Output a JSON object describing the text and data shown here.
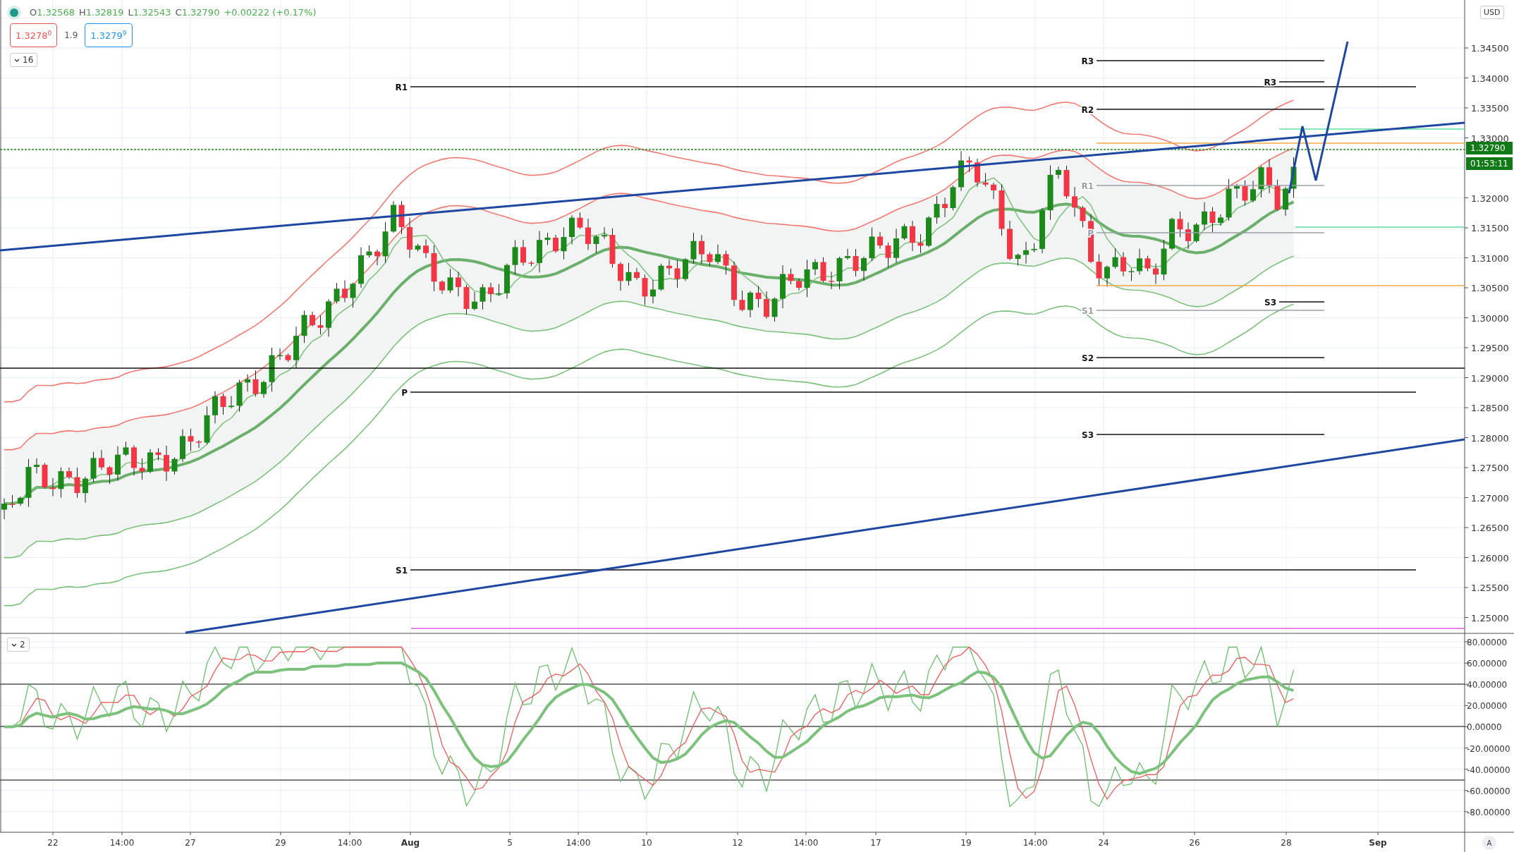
{
  "legend": {
    "ohlc": [
      {
        "label": "O",
        "value": "1.32568"
      },
      {
        "label": "H",
        "value": "1.32819"
      },
      {
        "label": "L",
        "value": "1.32543"
      },
      {
        "label": "C",
        "value": "1.32790"
      }
    ],
    "change": "+0.00222 (+0.17%)",
    "bid": "1.3278$^{0}$",
    "spread": "1.9",
    "ask": "1.3279$^{9}$",
    "collapse_count": "16"
  },
  "oscillator_pane": {
    "collapse_count": "2"
  },
  "currency_button": "USD",
  "price_tag": "1.32790",
  "countdown": "01:53:11",
  "pivots": [
    {
      "label": "R1",
      "muted": false
    },
    {
      "label": "P",
      "muted": false
    },
    {
      "label": "S1",
      "muted": false
    },
    {
      "label": "R3",
      "muted": false
    },
    {
      "label": "R2",
      "muted": false
    },
    {
      "label": "R1",
      "muted": true
    },
    {
      "label": "P",
      "muted": true
    },
    {
      "label": "S1",
      "muted": true
    },
    {
      "label": "S2",
      "muted": false
    },
    {
      "label": "S3",
      "muted": false
    },
    {
      "label": "R3",
      "muted": false
    },
    {
      "label": "S3",
      "muted": false
    }
  ],
  "price_axis": [
    "1.34500",
    "1.34000",
    "1.33500",
    "1.33000",
    "1.32000",
    "1.31500",
    "1.31000",
    "1.30500",
    "1.30000",
    "1.29500",
    "1.29000",
    "1.28500",
    "1.28000",
    "1.27500",
    "1.27000",
    "1.26500",
    "1.26000",
    "1.25500",
    "1.25000"
  ],
  "oscillator_axis": [
    "80.00000",
    "60.00000",
    "40.00000",
    "20.00000",
    "0.00000",
    "-20.00000",
    "-40.00000",
    "-60.00000",
    "-80.00000"
  ],
  "time_axis": [
    {
      "label": "22",
      "kind": "day"
    },
    {
      "label": "14:00",
      "kind": "time"
    },
    {
      "label": "27",
      "kind": "day"
    },
    {
      "label": "29",
      "kind": "day"
    },
    {
      "label": "14:00",
      "kind": "time"
    },
    {
      "label": "Aug",
      "kind": "month"
    },
    {
      "label": "5",
      "kind": "day"
    },
    {
      "label": "14:00",
      "kind": "time"
    },
    {
      "label": "10",
      "kind": "day"
    },
    {
      "label": "12",
      "kind": "day"
    },
    {
      "label": "14:00",
      "kind": "time"
    },
    {
      "label": "17",
      "kind": "day"
    },
    {
      "label": "19",
      "kind": "day"
    },
    {
      "label": "14:00",
      "kind": "time"
    },
    {
      "label": "24",
      "kind": "day"
    },
    {
      "label": "26",
      "kind": "day"
    },
    {
      "label": "28",
      "kind": "day"
    },
    {
      "label": "Sep",
      "kind": "month"
    }
  ],
  "auto_scale_button": "A"
}
